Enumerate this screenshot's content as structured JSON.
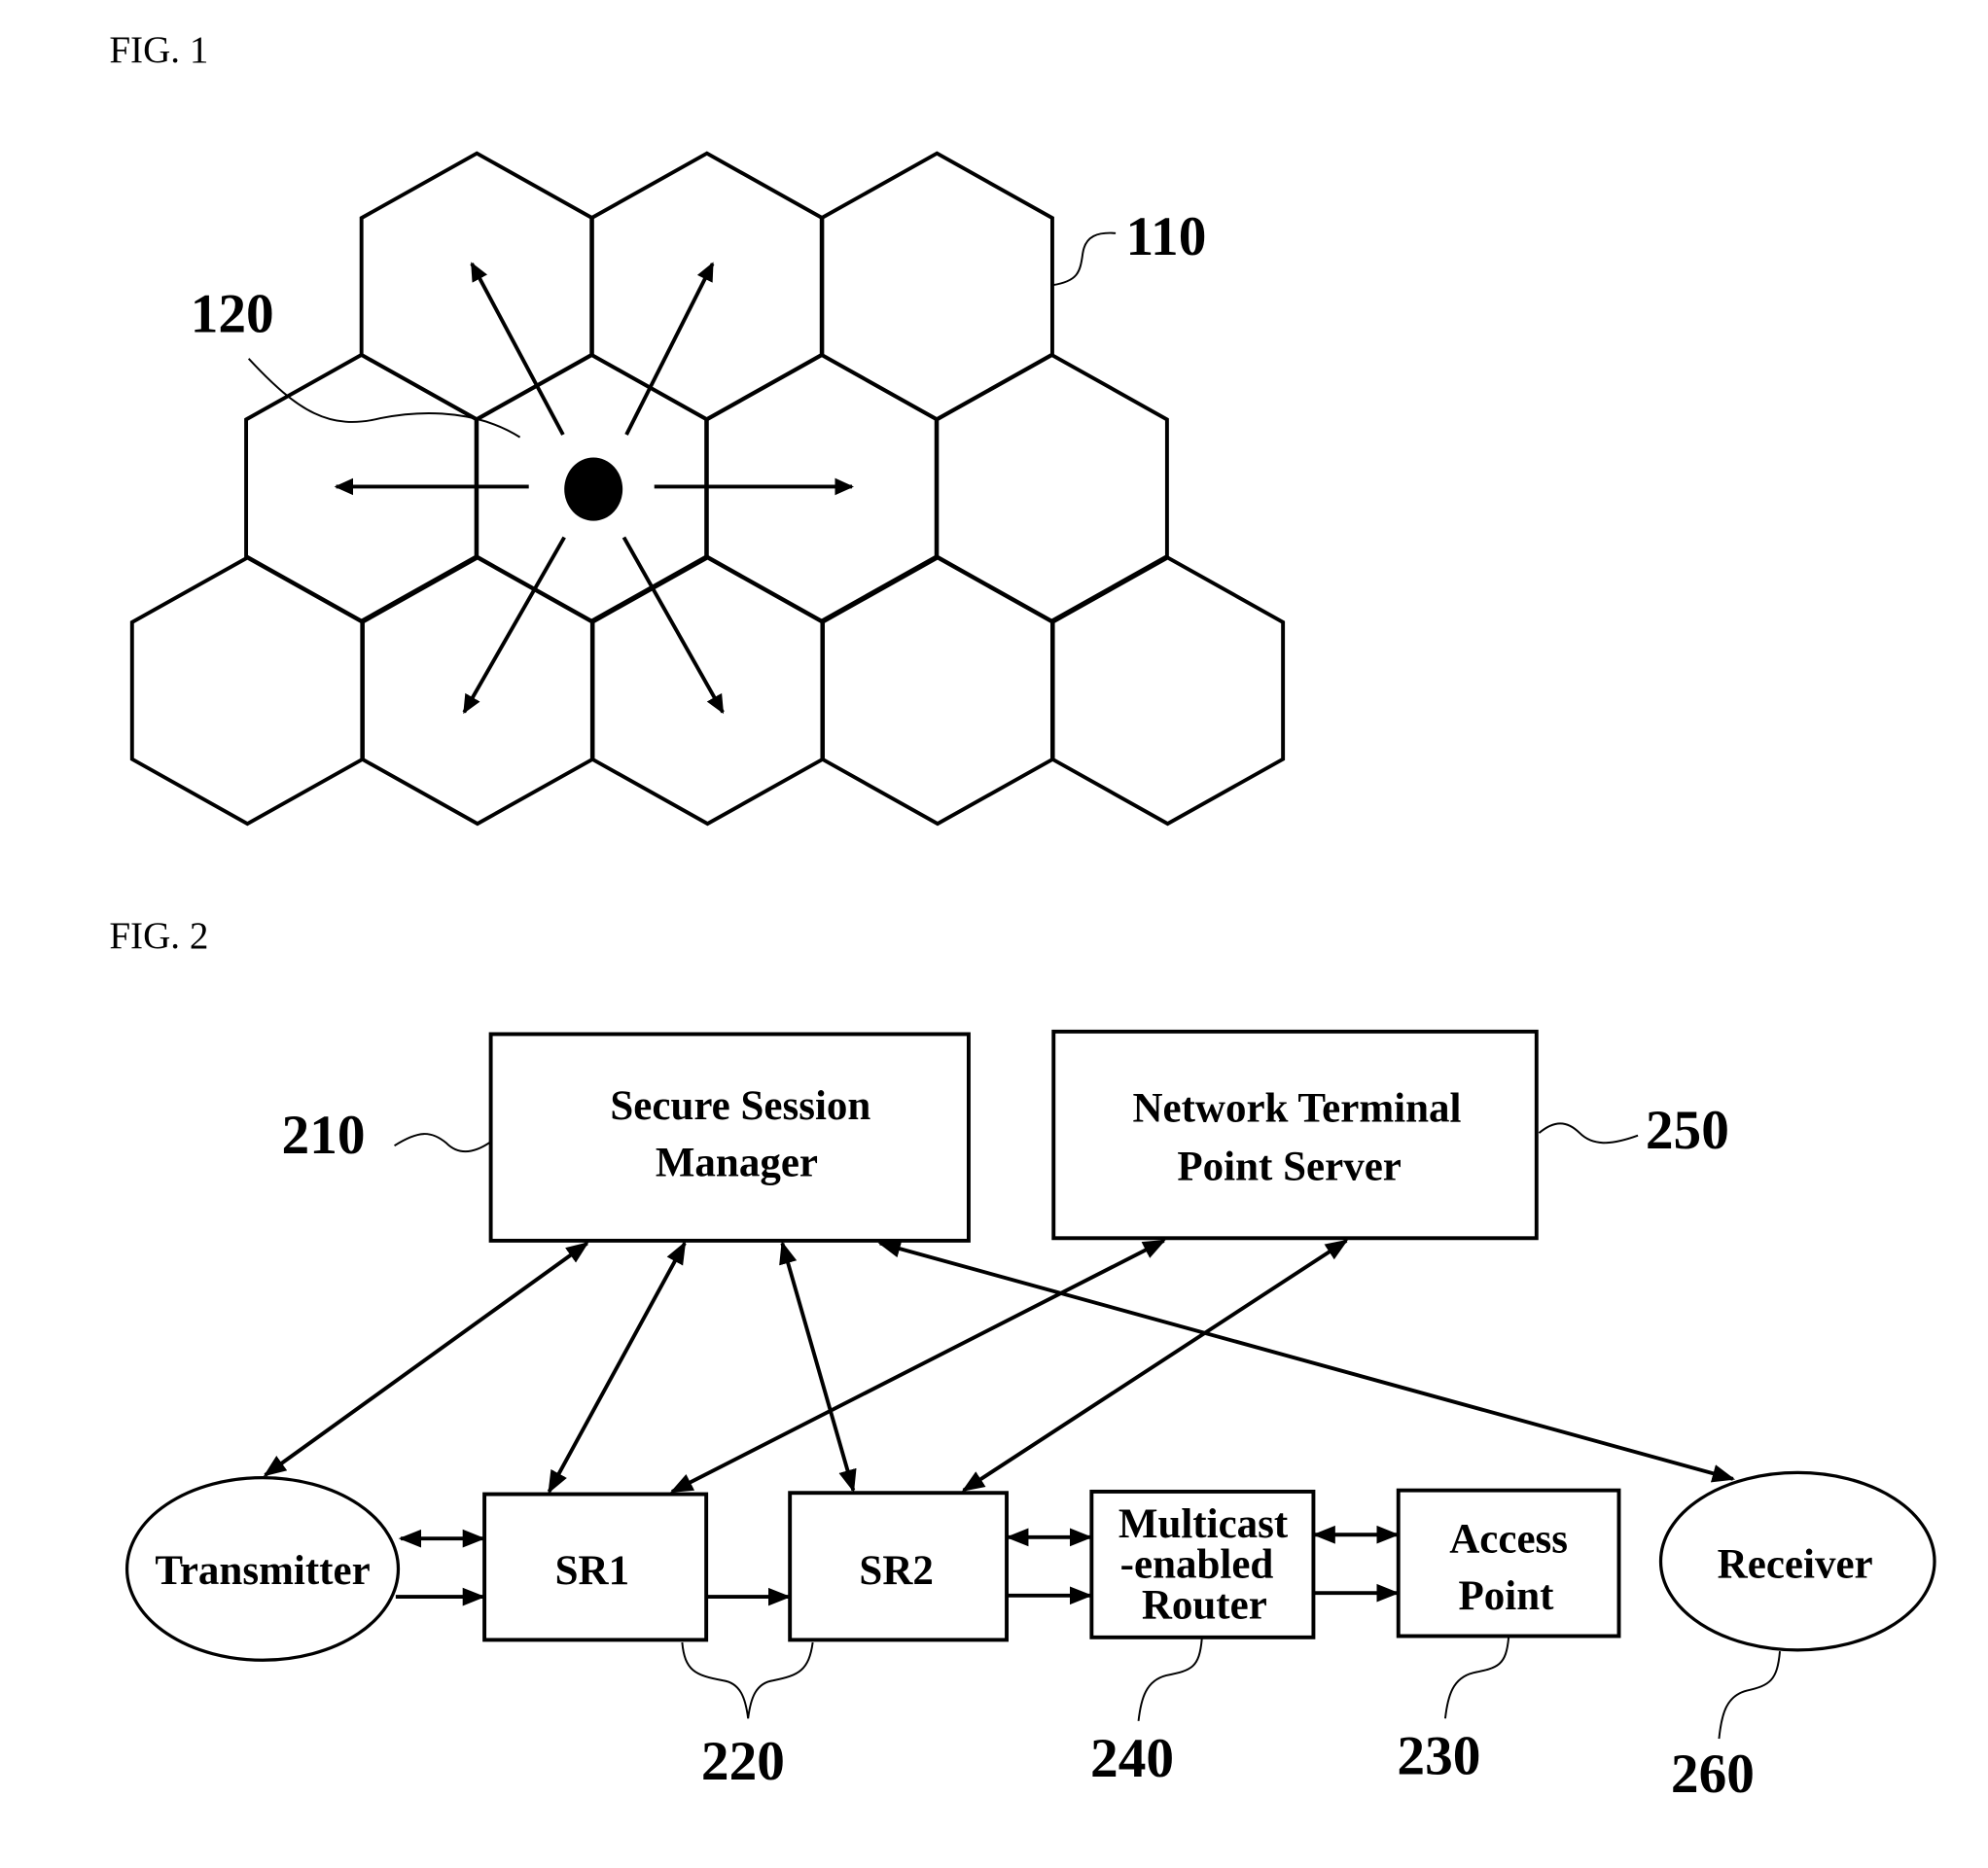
{
  "fig1": {
    "label": "FIG. 1",
    "ref_cell": "110",
    "ref_center": "120",
    "cells": [
      {
        "row": 0,
        "col": 0,
        "pattern": "diag-right"
      },
      {
        "row": 0,
        "col": 1,
        "pattern": "diag-left"
      },
      {
        "row": 0,
        "col": 2,
        "pattern": "none"
      },
      {
        "row": 1,
        "col": 0,
        "pattern": "diag-right"
      },
      {
        "row": 1,
        "col": 1,
        "pattern": "crosshatch"
      },
      {
        "row": 1,
        "col": 2,
        "pattern": "diag-left"
      },
      {
        "row": 1,
        "col": 3,
        "pattern": "none"
      },
      {
        "row": 2,
        "col": 0,
        "pattern": "none"
      },
      {
        "row": 2,
        "col": 1,
        "pattern": "horizontal"
      },
      {
        "row": 2,
        "col": 2,
        "pattern": "horizontal"
      },
      {
        "row": 2,
        "col": 3,
        "pattern": "none"
      },
      {
        "row": 2,
        "col": 4,
        "pattern": "none"
      }
    ]
  },
  "fig2": {
    "label": "FIG. 2",
    "nodes": {
      "ssm": {
        "lines": [
          "Secure Session",
          "Manager"
        ],
        "ref": "210"
      },
      "ntps": {
        "lines": [
          "Network Terminal",
          "Point Server"
        ],
        "ref": "250"
      },
      "transmitter": {
        "lines": [
          "Transmitter"
        ]
      },
      "sr1": {
        "lines": [
          "SR1"
        ]
      },
      "sr2": {
        "lines": [
          "SR2"
        ]
      },
      "router": {
        "lines": [
          "Multicast",
          "-enabled",
          "Router"
        ],
        "ref": "240"
      },
      "ap": {
        "lines": [
          "Access",
          "Point"
        ],
        "ref": "230"
      },
      "receiver": {
        "lines": [
          "Receiver"
        ],
        "ref": "260"
      }
    },
    "sr_group_ref": "220",
    "links": [
      {
        "from": "ssm",
        "to": "transmitter",
        "type": "bidirectional"
      },
      {
        "from": "ssm",
        "to": "sr1",
        "type": "bidirectional"
      },
      {
        "from": "ssm",
        "to": "sr2",
        "type": "bidirectional"
      },
      {
        "from": "ssm",
        "to": "receiver",
        "type": "bidirectional"
      },
      {
        "from": "ntps",
        "to": "sr1",
        "type": "bidirectional"
      },
      {
        "from": "ntps",
        "to": "sr2",
        "type": "bidirectional"
      },
      {
        "from": "transmitter",
        "to": "sr1",
        "type": "bidirectional"
      },
      {
        "from": "transmitter",
        "to": "sr1",
        "type": "forward"
      },
      {
        "from": "sr1",
        "to": "sr2",
        "type": "forward"
      },
      {
        "from": "sr2",
        "to": "router",
        "type": "bidirectional"
      },
      {
        "from": "sr2",
        "to": "router",
        "type": "forward"
      },
      {
        "from": "router",
        "to": "ap",
        "type": "bidirectional"
      },
      {
        "from": "router",
        "to": "ap",
        "type": "forward"
      }
    ]
  }
}
